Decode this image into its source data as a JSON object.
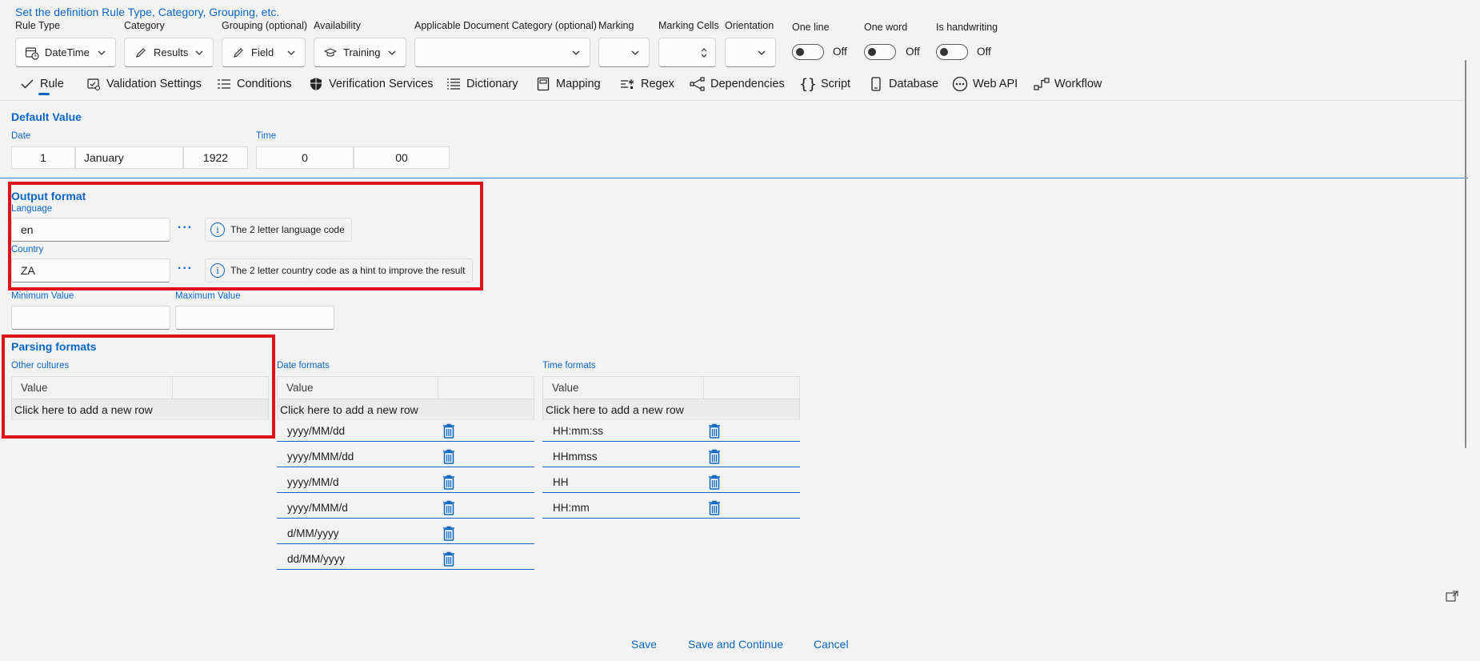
{
  "header": {
    "instruction": "Set the definition Rule Type, Category, Grouping, etc."
  },
  "fields": {
    "rule_type": {
      "label": "Rule Type",
      "value": "DateTime"
    },
    "category": {
      "label": "Category",
      "value": "Results"
    },
    "grouping": {
      "label": "Grouping (optional)",
      "value": "Field"
    },
    "availability": {
      "label": "Availability",
      "value": "Training"
    },
    "applicable_doc_category": {
      "label": "Applicable Document Category (optional)",
      "value": ""
    },
    "marking": {
      "label": "Marking",
      "value": ""
    },
    "marking_cells": {
      "label": "Marking Cells",
      "value": ""
    },
    "orientation": {
      "label": "Orientation",
      "value": ""
    },
    "one_line": {
      "label": "One line",
      "state": "Off"
    },
    "one_word": {
      "label": "One word",
      "state": "Off"
    },
    "is_handwriting": {
      "label": "Is handwriting",
      "state": "Off"
    }
  },
  "tabs": [
    {
      "label": "Rule",
      "icon": "check-icon",
      "active": true
    },
    {
      "label": "Validation Settings",
      "icon": "validation-icon"
    },
    {
      "label": "Conditions",
      "icon": "list-icon"
    },
    {
      "label": "Verification Services",
      "icon": "shield-icon"
    },
    {
      "label": "Dictionary",
      "icon": "bullet-list-icon"
    },
    {
      "label": "Mapping",
      "icon": "book-icon"
    },
    {
      "label": "Regex",
      "icon": "regex-icon"
    },
    {
      "label": "Dependencies",
      "icon": "share-icon"
    },
    {
      "label": "Script",
      "icon": "braces-icon"
    },
    {
      "label": "Database",
      "icon": "device-icon"
    },
    {
      "label": "Web API",
      "icon": "ellipsis-circle-icon"
    },
    {
      "label": "Workflow",
      "icon": "workflow-icon"
    }
  ],
  "default_value": {
    "title": "Default Value",
    "date_label": "Date",
    "day": "1",
    "month": "January",
    "year": "1922",
    "time_label": "Time",
    "hour": "0",
    "minute": "00"
  },
  "output_format": {
    "title": "Output format",
    "language_label": "Language",
    "language_value": "en",
    "language_hint": "The 2 letter language code",
    "country_label": "Country",
    "country_value": "ZA",
    "country_hint": "The 2 letter country code as a hint to improve the result"
  },
  "min_max": {
    "min_label": "Minimum Value",
    "min_value": "",
    "max_label": "Maximum Value",
    "max_value": ""
  },
  "parsing_formats": {
    "title": "Parsing formats",
    "other_cultures": {
      "label": "Other cultures",
      "header": "Value",
      "add_row": "Click here to add a new row",
      "rows": []
    },
    "date_formats": {
      "label": "Date formats",
      "header": "Value",
      "add_row": "Click here to add a new row",
      "rows": [
        "yyyy/MM/dd",
        "yyyy/MMM/dd",
        "yyyy/MM/d",
        "yyyy/MMM/d",
        "d/MM/yyyy",
        "dd/MM/yyyy"
      ]
    },
    "time_formats": {
      "label": "Time formats",
      "header": "Value",
      "add_row": "Click here to add a new row",
      "rows": [
        "HH:mm:ss",
        "HHmmss",
        "HH",
        "HH:mm"
      ]
    }
  },
  "footer": {
    "save": "Save",
    "save_continue": "Save and Continue",
    "cancel": "Cancel"
  },
  "colors": {
    "accent": "#0a66c2",
    "highlight": "#e0101d"
  }
}
